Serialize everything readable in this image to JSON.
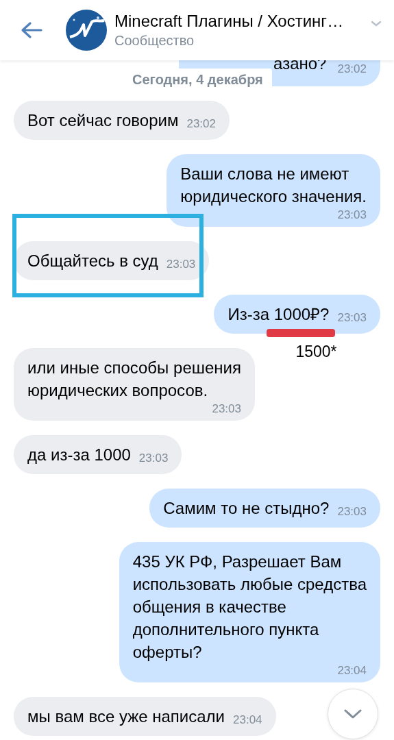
{
  "header": {
    "title": "Minecraft Плагины / Хостинг…",
    "subtitle": "Сообщество"
  },
  "date_separator": "Сегодня, 4 декабря",
  "messages": [
    {
      "kind": "clipped",
      "text": "азано?",
      "time": "23:02"
    },
    {
      "kind": "incoming",
      "text": "Вот сейчас говорим",
      "time": "23:02",
      "highlighted": false
    },
    {
      "kind": "outgoing",
      "text": "Ваши слова не имеют\nюридического значения.",
      "time": "23:03",
      "highlighted": false
    },
    {
      "kind": "incoming",
      "text": "Общайтесь в суд",
      "time": "23:03",
      "highlighted": true
    },
    {
      "kind": "outgoing",
      "text": "Из-за 1000₽?",
      "time": "23:03",
      "highlighted": false,
      "note": "1500*"
    },
    {
      "kind": "incoming",
      "text": "или иные способы решения\nюридических вопросов.",
      "time": "23:03",
      "highlighted": false
    },
    {
      "kind": "incoming",
      "text": "да из-за 1000",
      "time": "23:03",
      "highlighted": false
    },
    {
      "kind": "outgoing",
      "text": "Самим то не стыдно?",
      "time": "23:03",
      "highlighted": false
    },
    {
      "kind": "outgoing",
      "text": "435 УК РФ, Разрешает Вам\nиспользовать любые средства\nобщения в качестве\nдополнительного пункта\nоферты?",
      "time": "23:04",
      "highlighted": false
    },
    {
      "kind": "incoming",
      "text": "мы вам все уже написали",
      "time": "23:04",
      "highlighted": false
    }
  ]
}
